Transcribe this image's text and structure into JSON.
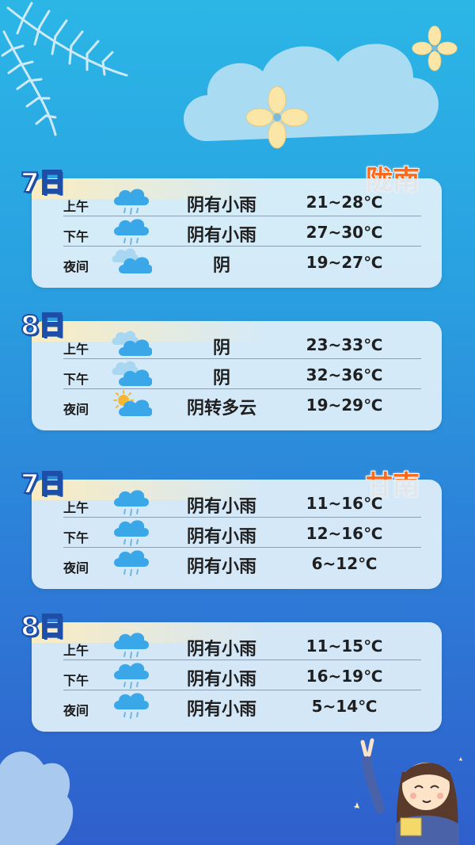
{
  "sections": [
    {
      "region": "陇南",
      "days": [
        {
          "label": "7日",
          "rows": [
            {
              "period": "上午",
              "icon": "rain-cloud-icon",
              "condition": "阴有小雨",
              "temp": "21~28℃"
            },
            {
              "period": "下午",
              "icon": "rain-cloud-icon",
              "condition": "阴有小雨",
              "temp": "27~30℃"
            },
            {
              "period": "夜间",
              "icon": "overcast-cloud-icon",
              "condition": "阴",
              "temp": "19~27℃"
            }
          ]
        },
        {
          "label": "8日",
          "rows": [
            {
              "period": "上午",
              "icon": "overcast-cloud-icon",
              "condition": "阴",
              "temp": "23~33℃"
            },
            {
              "period": "下午",
              "icon": "overcast-cloud-icon",
              "condition": "阴",
              "temp": "32~36℃"
            },
            {
              "period": "夜间",
              "icon": "sun-cloud-icon",
              "condition": "阴转多云",
              "temp": "19~29℃"
            }
          ]
        }
      ]
    },
    {
      "region": "甘南",
      "days": [
        {
          "label": "7日",
          "rows": [
            {
              "period": "上午",
              "icon": "rain-cloud-icon",
              "condition": "阴有小雨",
              "temp": "11~16℃"
            },
            {
              "period": "下午",
              "icon": "rain-cloud-icon",
              "condition": "阴有小雨",
              "temp": "12~16℃"
            },
            {
              "period": "夜间",
              "icon": "rain-cloud-icon",
              "condition": "阴有小雨",
              "temp": "6~12℃"
            }
          ]
        },
        {
          "label": "8日",
          "rows": [
            {
              "period": "上午",
              "icon": "rain-cloud-icon",
              "condition": "阴有小雨",
              "temp": "11~15℃"
            },
            {
              "period": "下午",
              "icon": "rain-cloud-icon",
              "condition": "阴有小雨",
              "temp": "16~19℃"
            },
            {
              "period": "夜间",
              "icon": "rain-cloud-icon",
              "condition": "阴有小雨",
              "temp": "5~14℃"
            }
          ]
        }
      ]
    }
  ],
  "colors": {
    "region": "#ff6a1a",
    "day_label_outline": "#1e4fa8",
    "card": "#e1f0fa",
    "rain_cloud": "#3aa8e8"
  }
}
